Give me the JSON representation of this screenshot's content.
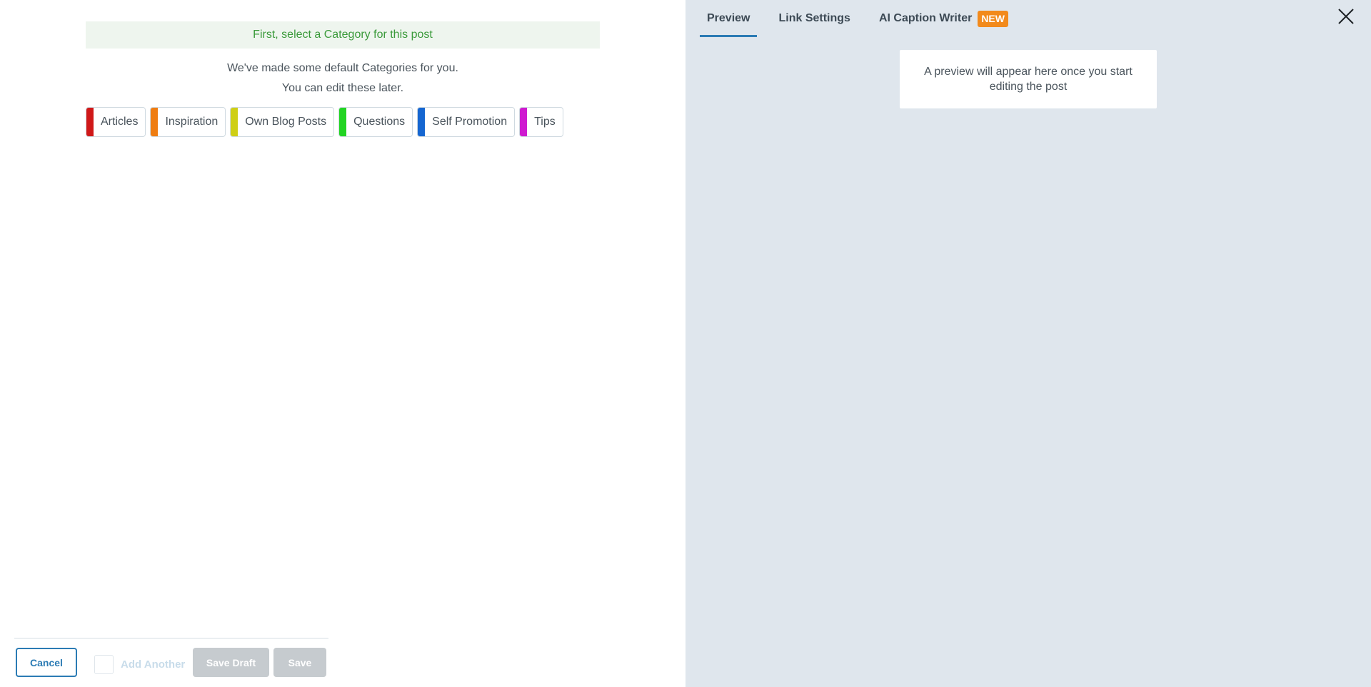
{
  "left": {
    "notice": "First, select a Category for this post",
    "intro_line1": "We've made some default Categories for you.",
    "intro_line2": "You can edit these later.",
    "categories": [
      {
        "label": "Articles",
        "color": "#d01818"
      },
      {
        "label": "Inspiration",
        "color": "#ef7d12"
      },
      {
        "label": "Own Blog Posts",
        "color": "#cfcf15"
      },
      {
        "label": "Questions",
        "color": "#22d422"
      },
      {
        "label": "Self Promotion",
        "color": "#1566d1"
      },
      {
        "label": "Tips",
        "color": "#cf1ad0"
      }
    ]
  },
  "footer": {
    "cancel_label": "Cancel",
    "add_another_label": "Add Another",
    "save_draft_label": "Save Draft",
    "save_label": "Save"
  },
  "right": {
    "tabs": [
      {
        "label": "Preview",
        "active": true
      },
      {
        "label": "Link Settings",
        "active": false
      },
      {
        "label": "AI Caption Writer",
        "active": false,
        "badge": "NEW"
      }
    ],
    "preview_placeholder": "A preview will appear here once you start editing the post",
    "close_icon": "close-icon"
  },
  "colors": {
    "accent": "#2b7bb4",
    "badge": "#f28a1c",
    "notice_text": "#3a9a3a",
    "right_bg": "#dfe6ed"
  }
}
